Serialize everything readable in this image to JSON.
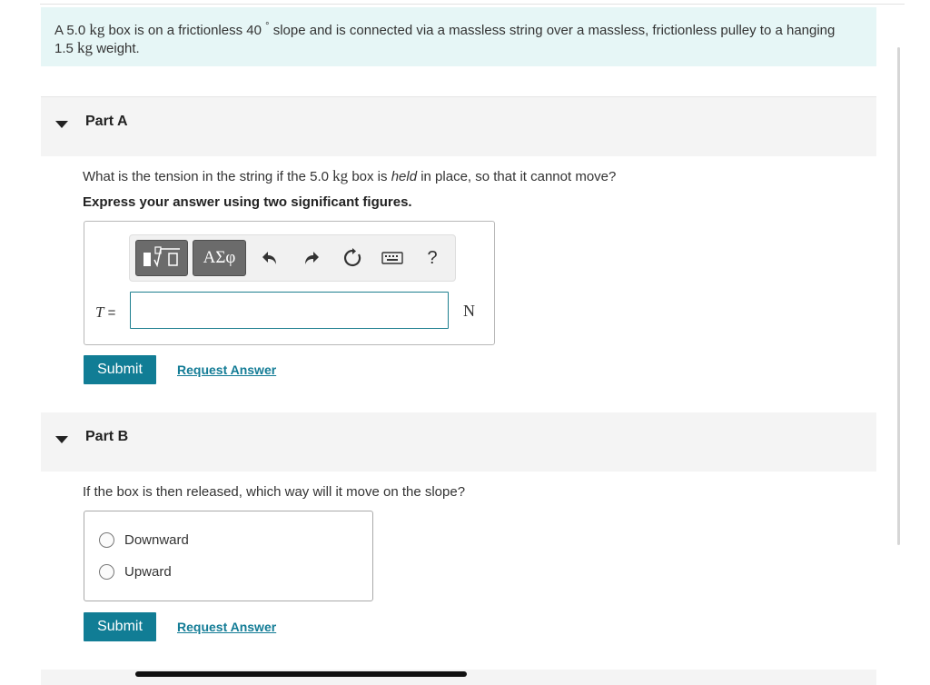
{
  "problem": {
    "p1": "A 5.0 ",
    "mass_box_unit": "kg",
    "p2": " box is on a frictionless 40 ",
    "degree": "°",
    "p3": " slope and is connected via a massless string over a massless, frictionless pulley to a hanging",
    "p4": "1.5 ",
    "mass_weight_unit": "kg",
    "p5": " weight."
  },
  "part_a": {
    "title": "Part A",
    "question_pre": "What is the tension in the string if the 5.0 ",
    "question_unit": "kg",
    "question_mid": " box is ",
    "question_em": "held",
    "question_post": " in place, so that it cannot move?",
    "instruction": "Express your answer using two significant figures.",
    "toolbar": {
      "templates_icon": "templates-icon",
      "greek_label": "ΑΣφ",
      "undo_icon": "undo-icon",
      "redo_icon": "redo-icon",
      "reset_icon": "reset-icon",
      "keyboard_icon": "keyboard-icon",
      "help_label": "?"
    },
    "variable": "T",
    "equals": "=",
    "input_value": "",
    "unit": "N",
    "submit_label": "Submit",
    "request_answer_label": "Request Answer"
  },
  "part_b": {
    "title": "Part B",
    "question": "If the box is then released, which way will it move on the slope?",
    "options": [
      "Downward",
      "Upward"
    ],
    "submit_label": "Submit",
    "request_answer_label": "Request Answer"
  },
  "colors": {
    "problem_bg": "#e6f6f6",
    "accent": "#117d95",
    "link": "#137c96"
  }
}
